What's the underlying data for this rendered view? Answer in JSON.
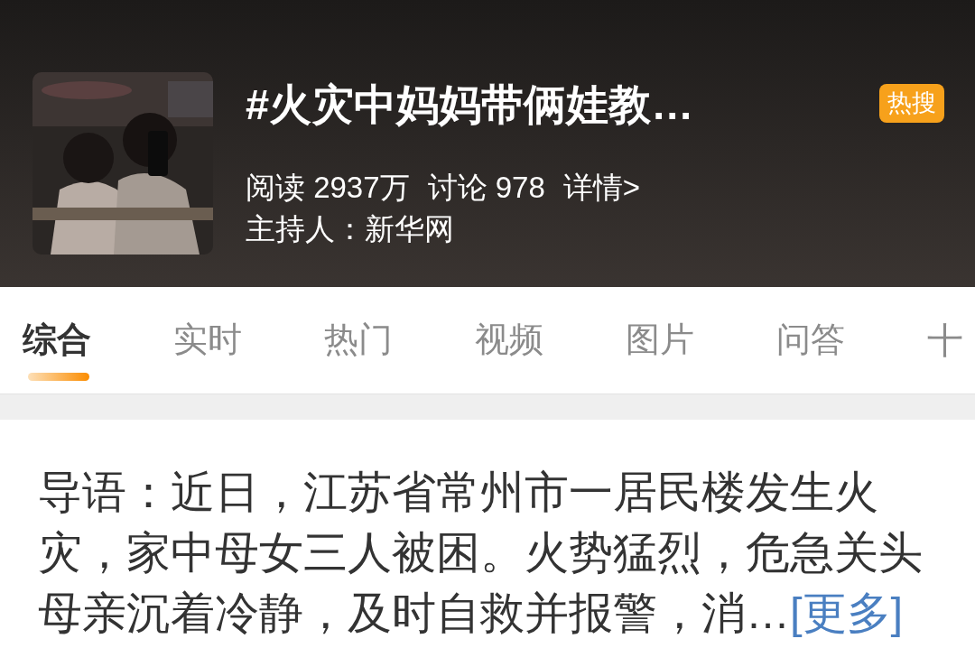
{
  "topic": {
    "title": "#火灾中妈妈带俩娃教…",
    "badge": "热搜",
    "stats": [
      {
        "label": "阅读",
        "value": "2937万"
      },
      {
        "label": "讨论",
        "value": "978"
      }
    ],
    "details_link": "详情>",
    "host_label": "主持人：",
    "host": "新华网"
  },
  "tabs": [
    {
      "label": "综合",
      "selected": true
    },
    {
      "label": "实时",
      "selected": false
    },
    {
      "label": "热门",
      "selected": false
    },
    {
      "label": "视频",
      "selected": false
    },
    {
      "label": "图片",
      "selected": false
    },
    {
      "label": "问答",
      "selected": false
    }
  ],
  "add_tab": "十",
  "post": {
    "text": "导语：近日，江苏省常州市一居民楼发生火灾，家中母女三人被困。火势猛烈，危急关头母亲沉着冷静，及时自救并报警，消…",
    "more_link": "[更多]"
  }
}
